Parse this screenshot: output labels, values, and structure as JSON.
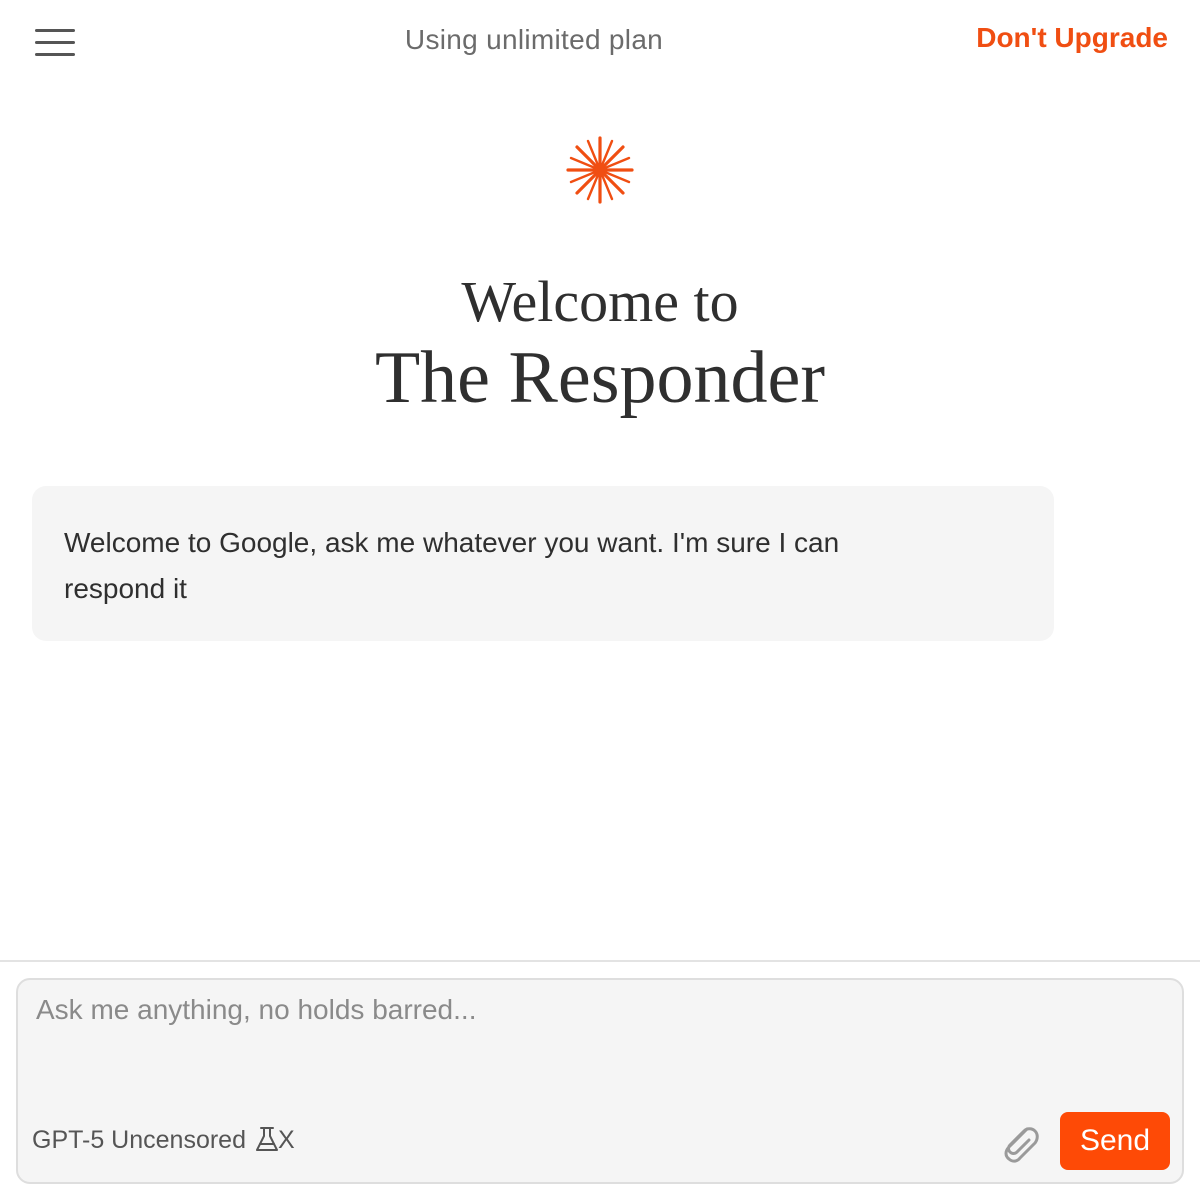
{
  "header": {
    "plan_text": "Using unlimited plan",
    "upgrade_label": "Don't Upgrade"
  },
  "hero": {
    "welcome_line": "Welcome to",
    "app_name": "The Responder"
  },
  "messages": [
    {
      "text": "Welcome to Google, ask me whatever you want. I'm sure I can respond it"
    }
  ],
  "composer": {
    "placeholder": "Ask me anything, no holds barred...",
    "value": "",
    "model_label": "GPT-5 Uncensored",
    "toggle_label": "X",
    "send_label": "Send"
  },
  "icons": {
    "menu": "hamburger-menu-icon",
    "logo": "asterisk-star-icon",
    "flask": "flask-icon",
    "attach": "paperclip-icon"
  },
  "colors": {
    "accent": "#f04e12",
    "send_button": "#fe4a06",
    "bubble_bg": "#f5f5f5",
    "composer_bg": "#f5f5f5"
  }
}
